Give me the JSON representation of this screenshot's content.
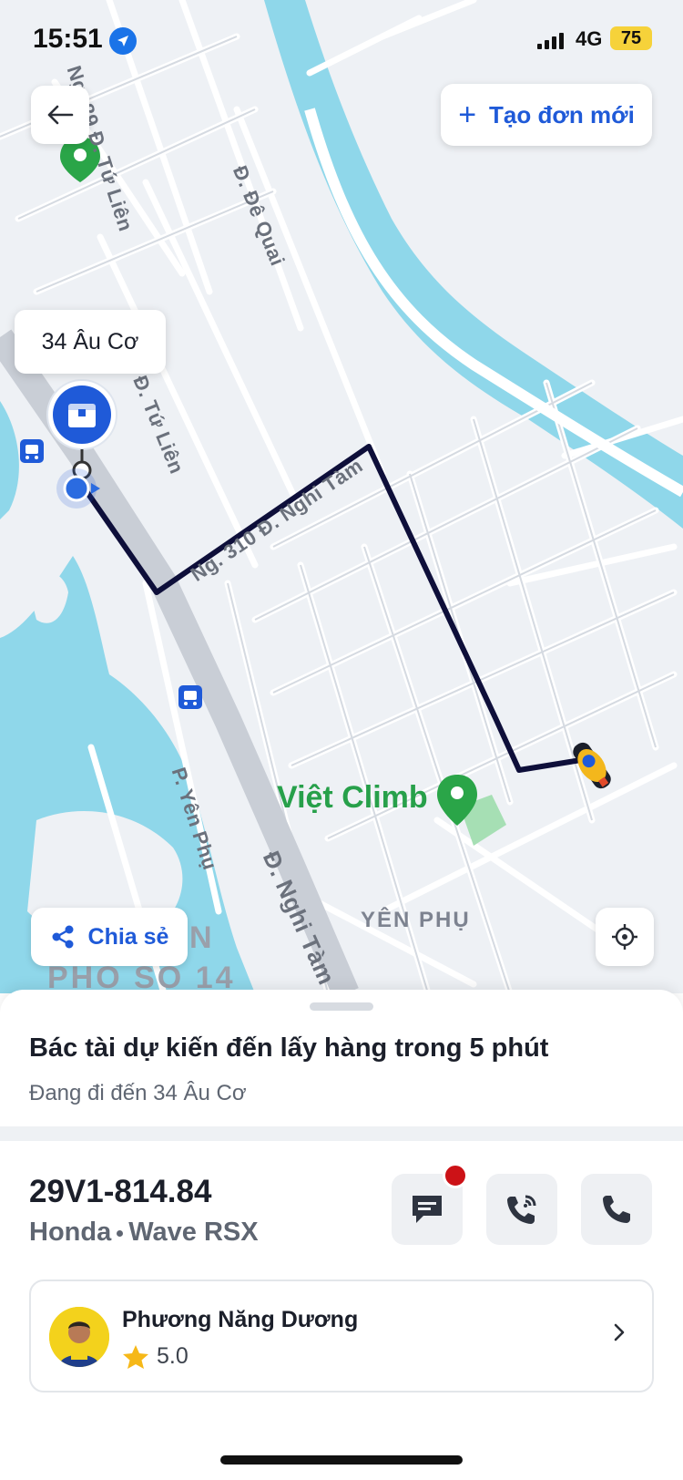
{
  "status_bar": {
    "time": "15:51",
    "network": "4G",
    "battery": "75"
  },
  "map": {
    "new_order_label": "Tạo đơn mới",
    "pickup_label": "34 Âu Cơ",
    "share_label": "Chia sẻ",
    "poi_name": "Việt Climb",
    "roads": {
      "ng89": "Ng. 89 Đ. Tứ Liên",
      "de_quai": "Đ. Đê Quai",
      "tu_lien": "Ng. Đ. Tứ Liên",
      "nghi_tam_lane": "Ng. 310 Đ. Nghi Tàm",
      "yen_phu": "P. Yên Phụ",
      "nghi_tam": "Đ. Nghi Tàm"
    },
    "areas": {
      "yen_phu": "YÊN PHỤ",
      "pho_so": "PHỐ SỐ 14",
      "letter_n": "N"
    },
    "icons": [
      "location-arrow-icon",
      "back-arrow-icon",
      "plus-icon",
      "share-icon",
      "crosshair-icon",
      "bus-stop-icon",
      "pin-icon",
      "motorbike-icon",
      "package-icon"
    ]
  },
  "trip": {
    "eta_title": "Bác tài dự kiến đến lấy hàng trong 5 phút",
    "eta_sub": "Đang đi đến 34 Âu Cơ"
  },
  "vehicle": {
    "plate": "29V1-814.84",
    "make": "Honda",
    "model": "Wave RSX"
  },
  "driver": {
    "name": "Phương Năng Dương",
    "rating": "5.0"
  },
  "colors": {
    "accent": "#1f5ad8",
    "route": "#0e0f3a",
    "water": "#8fd7ea",
    "poi_green": "#27a04a",
    "alert": "#cc1217"
  }
}
